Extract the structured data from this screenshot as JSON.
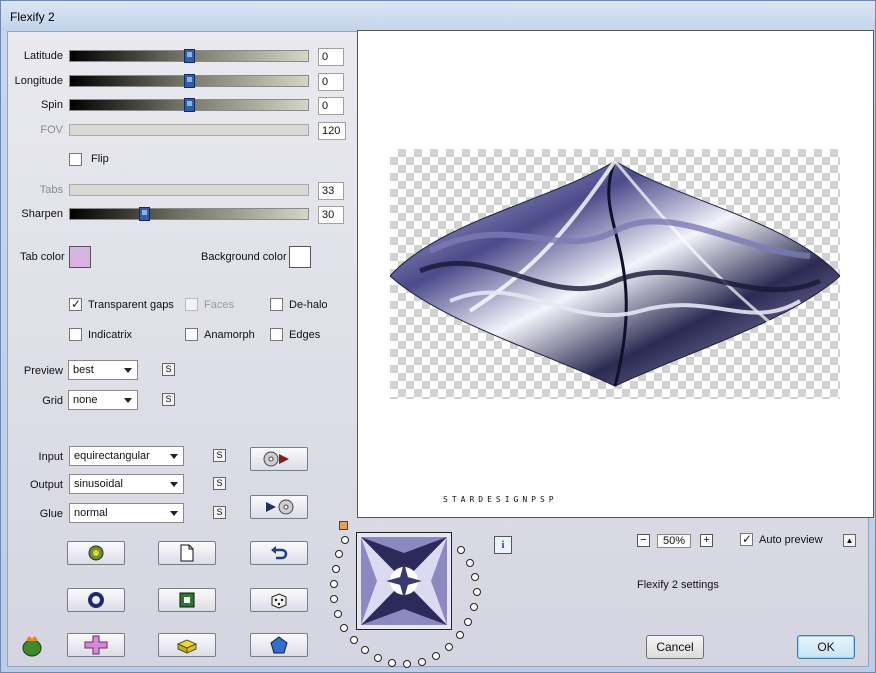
{
  "window": {
    "title": "Flexify 2"
  },
  "sliders": {
    "latitude": {
      "label": "Latitude",
      "value": "0",
      "position": 0.5,
      "enabled": true
    },
    "longitude": {
      "label": "Longitude",
      "value": "0",
      "position": 0.5,
      "enabled": true
    },
    "spin": {
      "label": "Spin",
      "value": "0",
      "position": 0.5,
      "enabled": true
    },
    "fov": {
      "label": "FOV",
      "value": "120",
      "enabled": false
    },
    "tabs": {
      "label": "Tabs",
      "value": "33",
      "enabled": false
    },
    "sharpen": {
      "label": "Sharpen",
      "value": "30",
      "position": 0.3,
      "enabled": true
    }
  },
  "flip": {
    "label": "Flip",
    "checked": false
  },
  "colors": {
    "tab_color": {
      "label": "Tab color",
      "value": "#d8b4e2"
    },
    "background_color": {
      "label": "Background color",
      "value": "#ffffff"
    }
  },
  "options": {
    "transparent_gaps": {
      "label": "Transparent gaps",
      "checked": true
    },
    "faces": {
      "label": "Faces",
      "checked": false,
      "enabled": false
    },
    "de_halo": {
      "label": "De-halo",
      "checked": false
    },
    "indicatrix": {
      "label": "Indicatrix",
      "checked": false
    },
    "anamorph": {
      "label": "Anamorph",
      "checked": false
    },
    "edges": {
      "label": "Edges",
      "checked": false
    }
  },
  "preview_select": {
    "label": "Preview",
    "value": "best"
  },
  "grid_select": {
    "label": "Grid",
    "value": "none"
  },
  "input_select": {
    "label": "Input",
    "value": "equirectangular"
  },
  "output_select": {
    "label": "Output",
    "value": "sinusoidal"
  },
  "glue_select": {
    "label": "Glue",
    "value": "normal"
  },
  "s_button_label": "S",
  "preview_panel": {
    "watermark": "STARDESIGNPSP"
  },
  "zoom": {
    "value": "50%",
    "minus": "−",
    "plus": "+"
  },
  "auto_preview": {
    "label": "Auto preview",
    "checked": true
  },
  "settings_label": "Flexify 2 settings",
  "buttons": {
    "cancel": "Cancel",
    "ok": "OK"
  },
  "accent_colors": {
    "thumb": "#2f5fa8",
    "tab_color": "#d8b4e2"
  }
}
